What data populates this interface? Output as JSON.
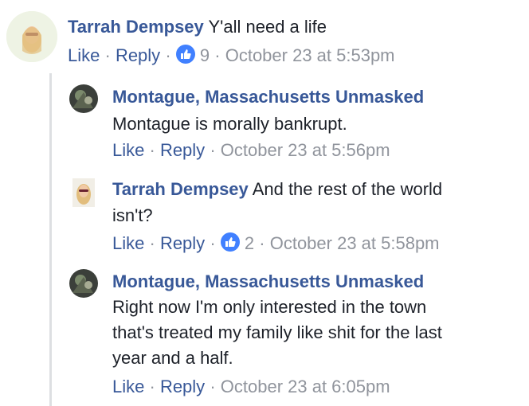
{
  "comments": [
    {
      "author": "Tarrah Dempsey",
      "text": "Y'all need a life",
      "like": "Like",
      "reply": "Reply",
      "reactions": "9",
      "time": "October 23 at 5:53pm"
    },
    {
      "author": "Montague, Massachusetts Unmasked",
      "text": "Montague is morally bankrupt.",
      "like": "Like",
      "reply": "Reply",
      "time": "October 23 at 5:56pm"
    },
    {
      "author": "Tarrah Dempsey",
      "text_line1": "And the rest of the world",
      "text_line2": "isn't?",
      "like": "Like",
      "reply": "Reply",
      "reactions": "2",
      "time": "October 23 at 5:58pm"
    },
    {
      "author": "Montague, Massachusetts Unmasked",
      "text_line1": "Right now I'm only interested in the town",
      "text_line2": "that's treated my family like shit for the last",
      "text_line3": "year and a half.",
      "like": "Like",
      "reply": "Reply",
      "time": "October 23 at 6:05pm"
    }
  ],
  "separator": "·",
  "colors": {
    "link": "#385898",
    "meta": "#90949c",
    "like_badge": "#4080ff",
    "thread_line": "#dddfe2"
  },
  "icons": {
    "reaction": "thumbs-up-icon"
  }
}
